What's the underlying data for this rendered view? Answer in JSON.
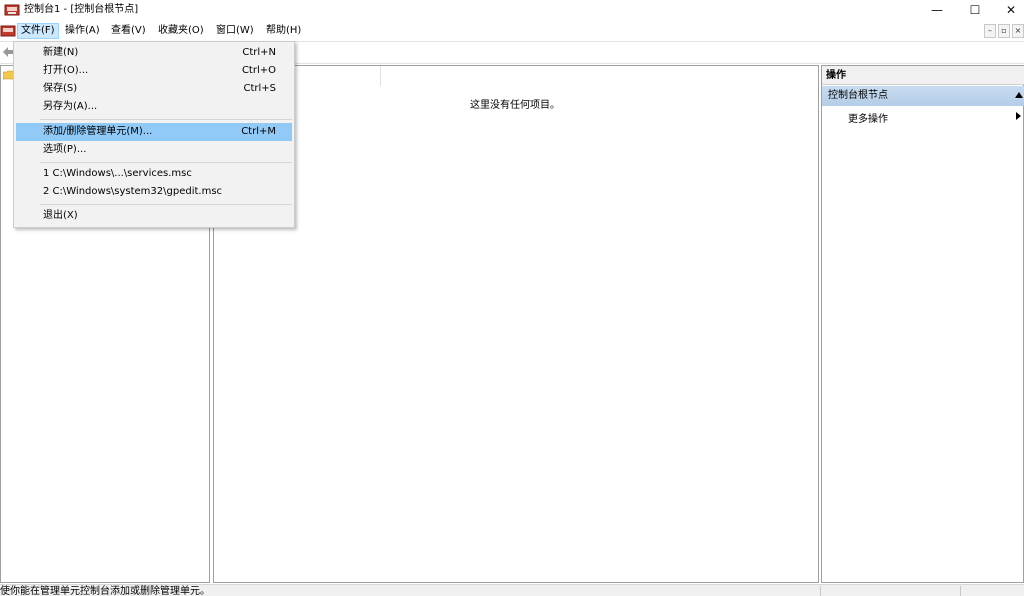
{
  "window": {
    "title": "控制台1 - [控制台根节点]",
    "minimize_glyph": "—",
    "maximize_glyph": "☐",
    "close_glyph": "✕"
  },
  "menubar": {
    "items": [
      {
        "label": "文件(F)",
        "active": true
      },
      {
        "label": "操作(A)"
      },
      {
        "label": "查看(V)"
      },
      {
        "label": "收藏夹(O)"
      },
      {
        "label": "窗口(W)"
      },
      {
        "label": "帮助(H)"
      }
    ],
    "mdi_buttons": [
      "–",
      "▫",
      "×"
    ]
  },
  "file_menu": {
    "items": [
      {
        "label": "新建(N)",
        "shortcut": "Ctrl+N"
      },
      {
        "label": "打开(O)...",
        "shortcut": "Ctrl+O"
      },
      {
        "label": "保存(S)",
        "shortcut": "Ctrl+S"
      },
      {
        "label": "另存为(A)...",
        "shortcut": ""
      },
      {
        "label": "添加/删除管理单元(M)...",
        "shortcut": "Ctrl+M",
        "highlighted": true
      },
      {
        "label": "选项(P)...",
        "shortcut": ""
      },
      {
        "label": "1 C:\\Windows\\...\\services.msc",
        "shortcut": ""
      },
      {
        "label": "2 C:\\Windows\\system32\\gpedit.msc",
        "shortcut": ""
      },
      {
        "label": "退出(X)",
        "shortcut": ""
      }
    ]
  },
  "center": {
    "empty_message": "这里没有任何项目。"
  },
  "actions_pane": {
    "header": "操作",
    "section_title": "控制台根节点",
    "more_actions": "更多操作"
  },
  "statusbar": {
    "text": "使你能在管理单元控制台添加或删除管理单元。"
  },
  "colors": {
    "menu_highlight": "#91c9f7",
    "active_menu": "#cce8ff",
    "actions_section": "#c8dcf0"
  }
}
